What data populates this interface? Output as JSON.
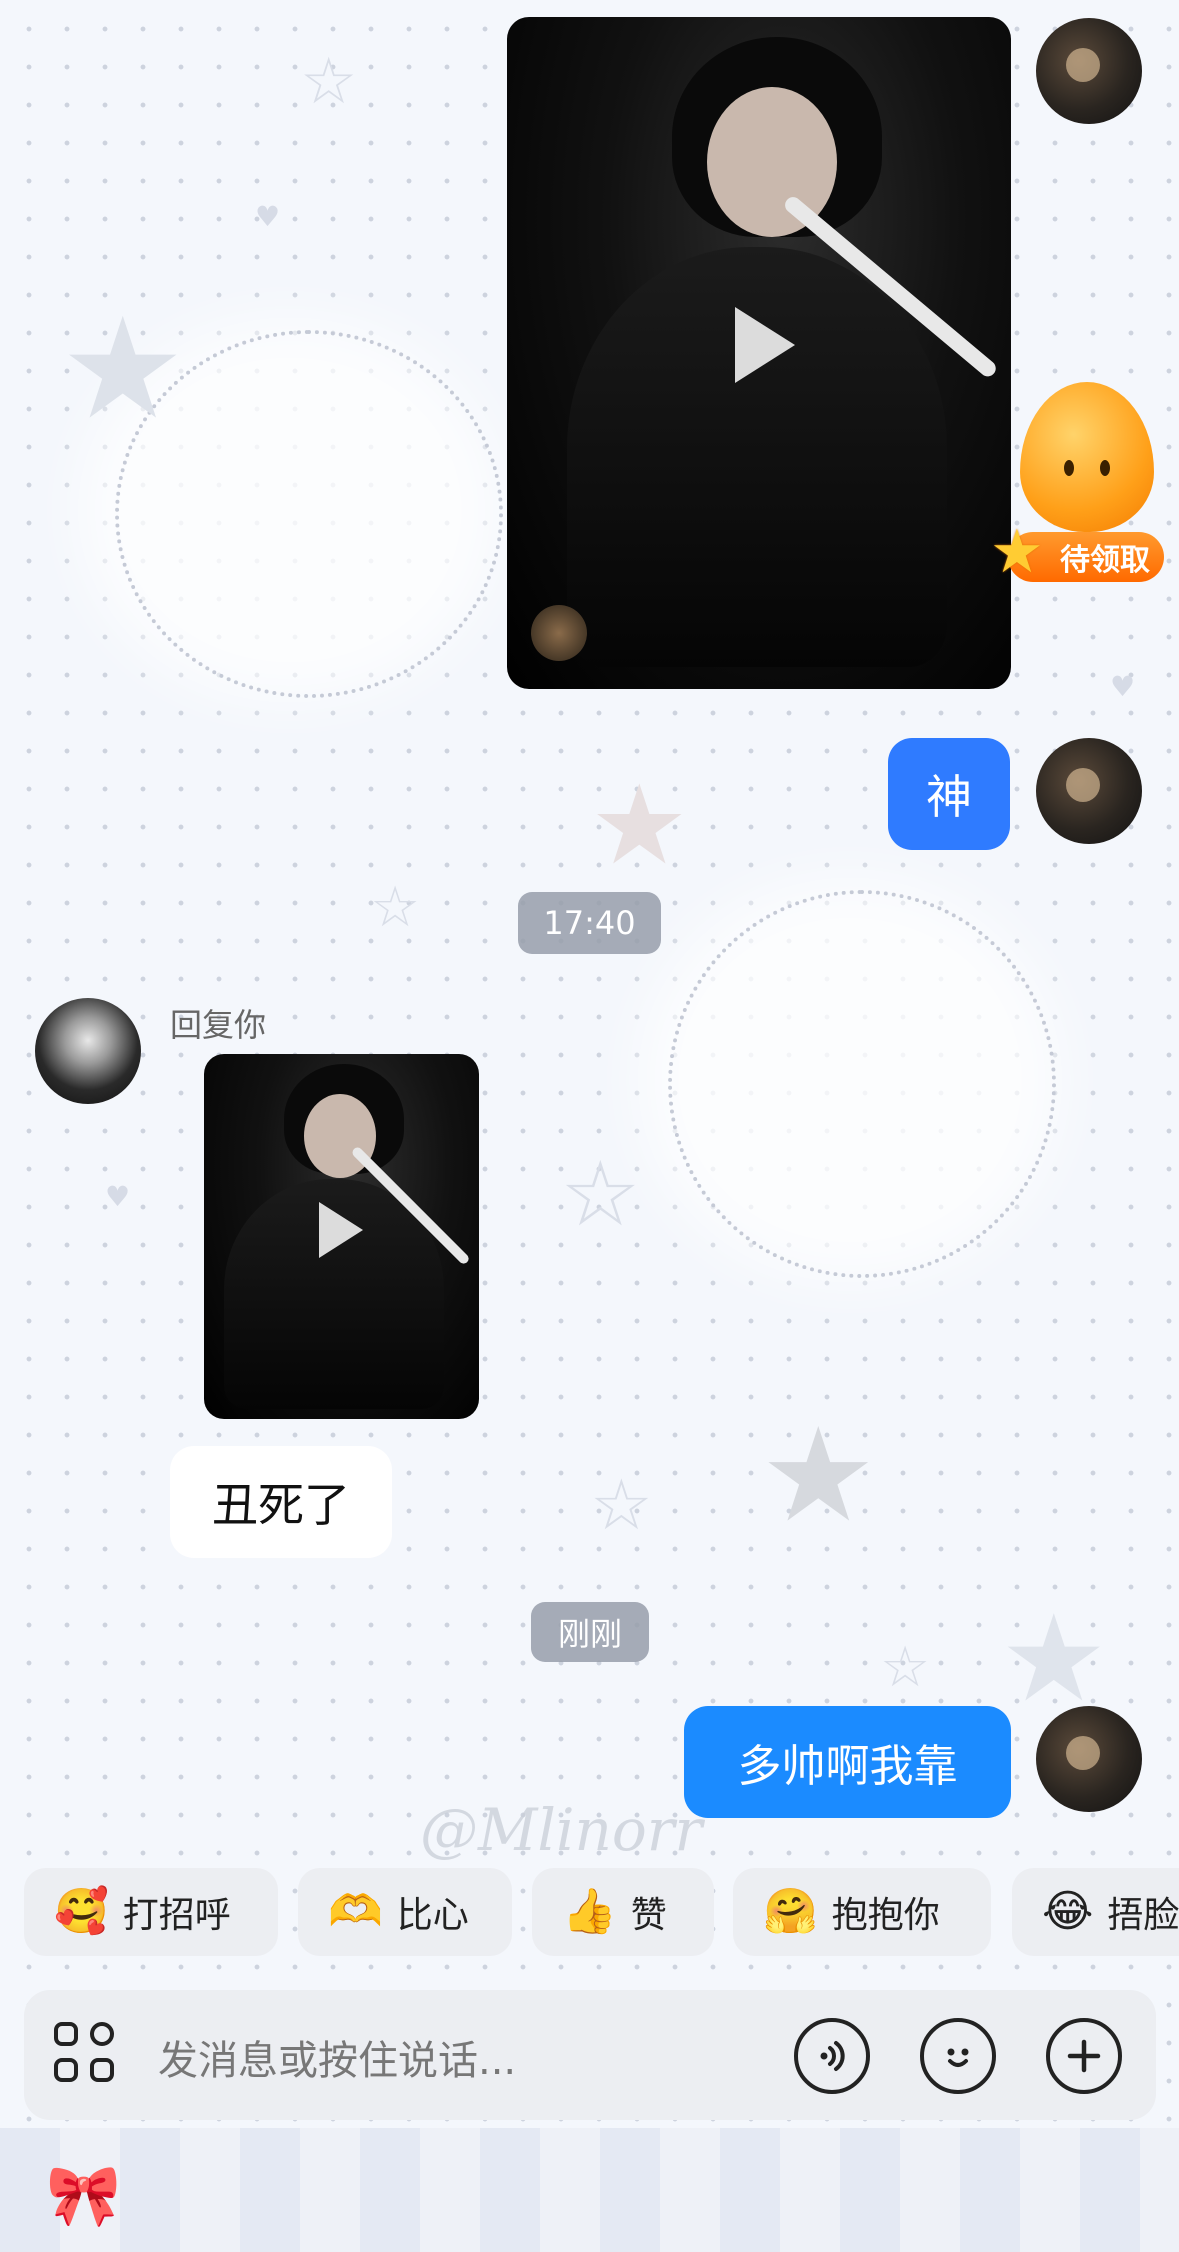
{
  "reward_badge": {
    "label": "待领取"
  },
  "messages": {
    "sent_text_1": "神",
    "timestamp_1": "17:40",
    "reply_label": "回复你",
    "received_text": "丑死了",
    "timestamp_2": "刚刚",
    "sent_text_2": "多帅啊我靠"
  },
  "watermark": "@Mlinorr",
  "quick_replies": [
    {
      "emoji": "🥰",
      "label": "打招呼"
    },
    {
      "emoji": "🫶",
      "label": "比心"
    },
    {
      "emoji": "👍",
      "label": "赞"
    },
    {
      "emoji": "🤗",
      "label": "抱抱你"
    },
    {
      "emoji": "😂",
      "label": "捂脸"
    }
  ],
  "input": {
    "placeholder": "发消息或按住说话..."
  },
  "icons": {
    "apps": "apps-grid-icon",
    "voice": "voice-icon",
    "emoji": "emoji-icon",
    "add": "plus-icon"
  },
  "colors": {
    "sent_bubble": "#2f7bff",
    "sent_bubble_2": "#1b8bff",
    "received_bubble": "#ffffff",
    "reward_orange": "#ff8a1a"
  }
}
